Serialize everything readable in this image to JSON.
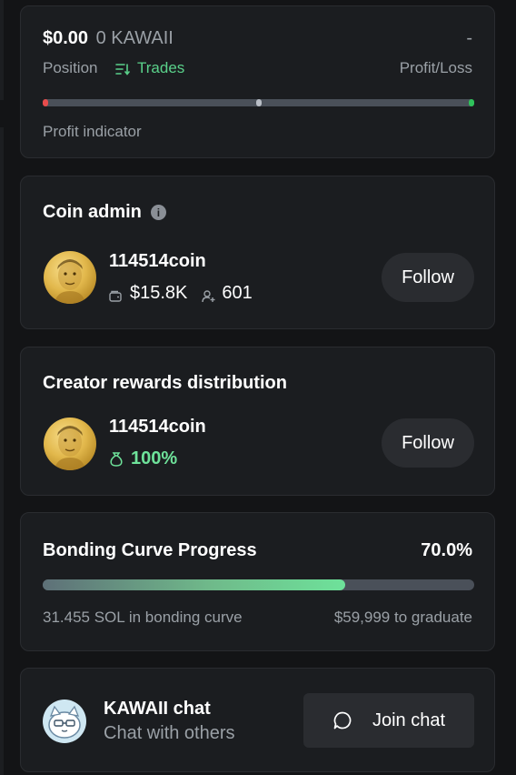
{
  "position": {
    "usd_value": "$0.00",
    "token_amount": "0 KAWAII",
    "pnl_value": "-",
    "position_label": "Position",
    "trades_label": "Trades",
    "profit_loss_label": "Profit/Loss",
    "indicator_label": "Profit indicator",
    "indicator_level": 0.5,
    "colors": {
      "loss": "#e84c4c",
      "gain": "#2fc25b",
      "neutral": "#b9bec6",
      "trades": "#5ad18a"
    }
  },
  "coin_admin": {
    "title": "Coin admin",
    "info_icon": "info-icon",
    "name": "114514coin",
    "market_cap": "$15.8K",
    "followers": "601",
    "follow_label": "Follow"
  },
  "creator_rewards": {
    "title": "Creator rewards distribution",
    "name": "114514coin",
    "share": "100%",
    "share_icon": "money-bag-icon",
    "follow_label": "Follow",
    "accent": "#6ee29a"
  },
  "bonding_curve": {
    "title": "Bonding Curve Progress",
    "percent_label": "70.0%",
    "progress": 0.7,
    "sol_text": "31.455 SOL in bonding curve",
    "graduate_text": "$59,999 to graduate"
  },
  "chat": {
    "title": "KAWAII chat",
    "subtitle": "Chat with others",
    "join_label": "Join chat",
    "join_icon": "chat-bubble-icon"
  }
}
